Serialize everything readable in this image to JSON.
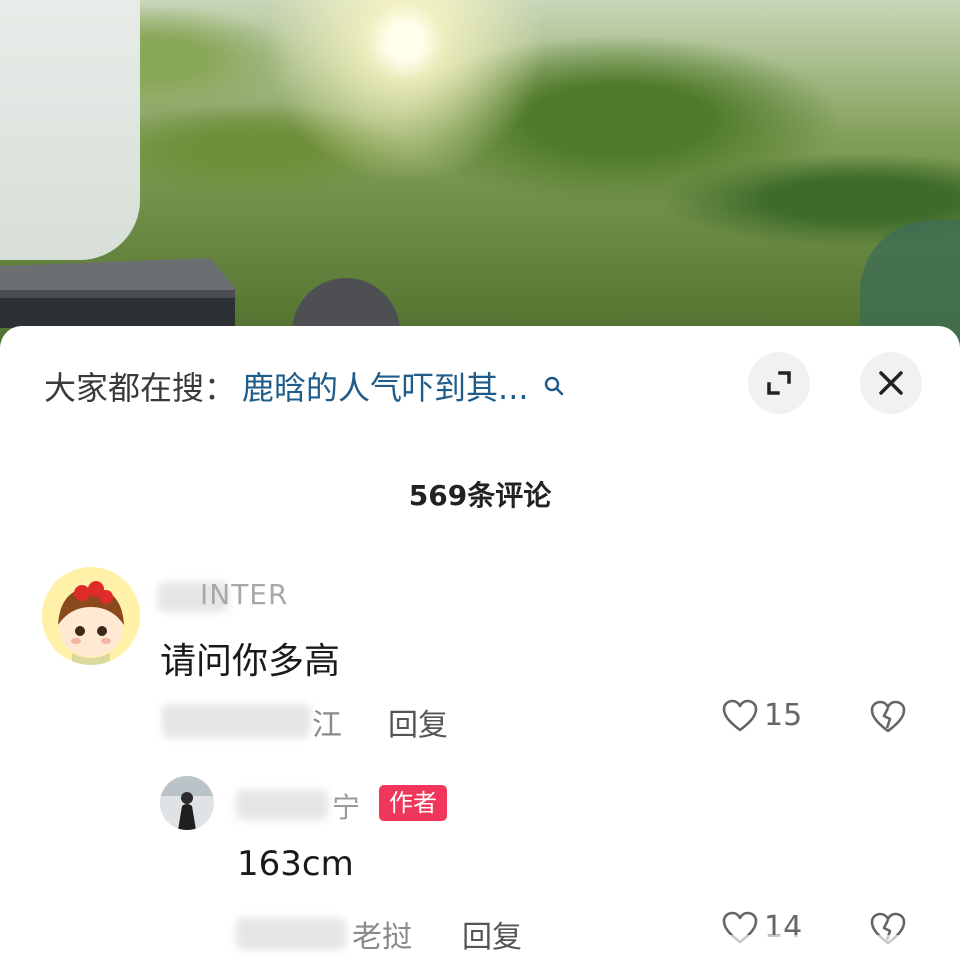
{
  "search_bar": {
    "prefix": "大家都在搜：",
    "query": "鹿晗的人气吓到其..."
  },
  "header": {
    "comment_count": "569条评论"
  },
  "comments": [
    {
      "username_visible": "INTER",
      "text": "请问你多高",
      "location_visible": "江",
      "reply_label": "回复",
      "likes": "15"
    }
  ],
  "replies": [
    {
      "username_visible": "宁",
      "badge": "作者",
      "text": "163cm",
      "location_visible": "老挝",
      "reply_label": "回复",
      "likes": "14"
    }
  ],
  "colors": {
    "query_link": "#1f5c8a",
    "author_badge": "#f0365a"
  },
  "icons": [
    "search-icon",
    "expand-icon",
    "close-icon",
    "heart-icon",
    "broken-heart-icon"
  ]
}
